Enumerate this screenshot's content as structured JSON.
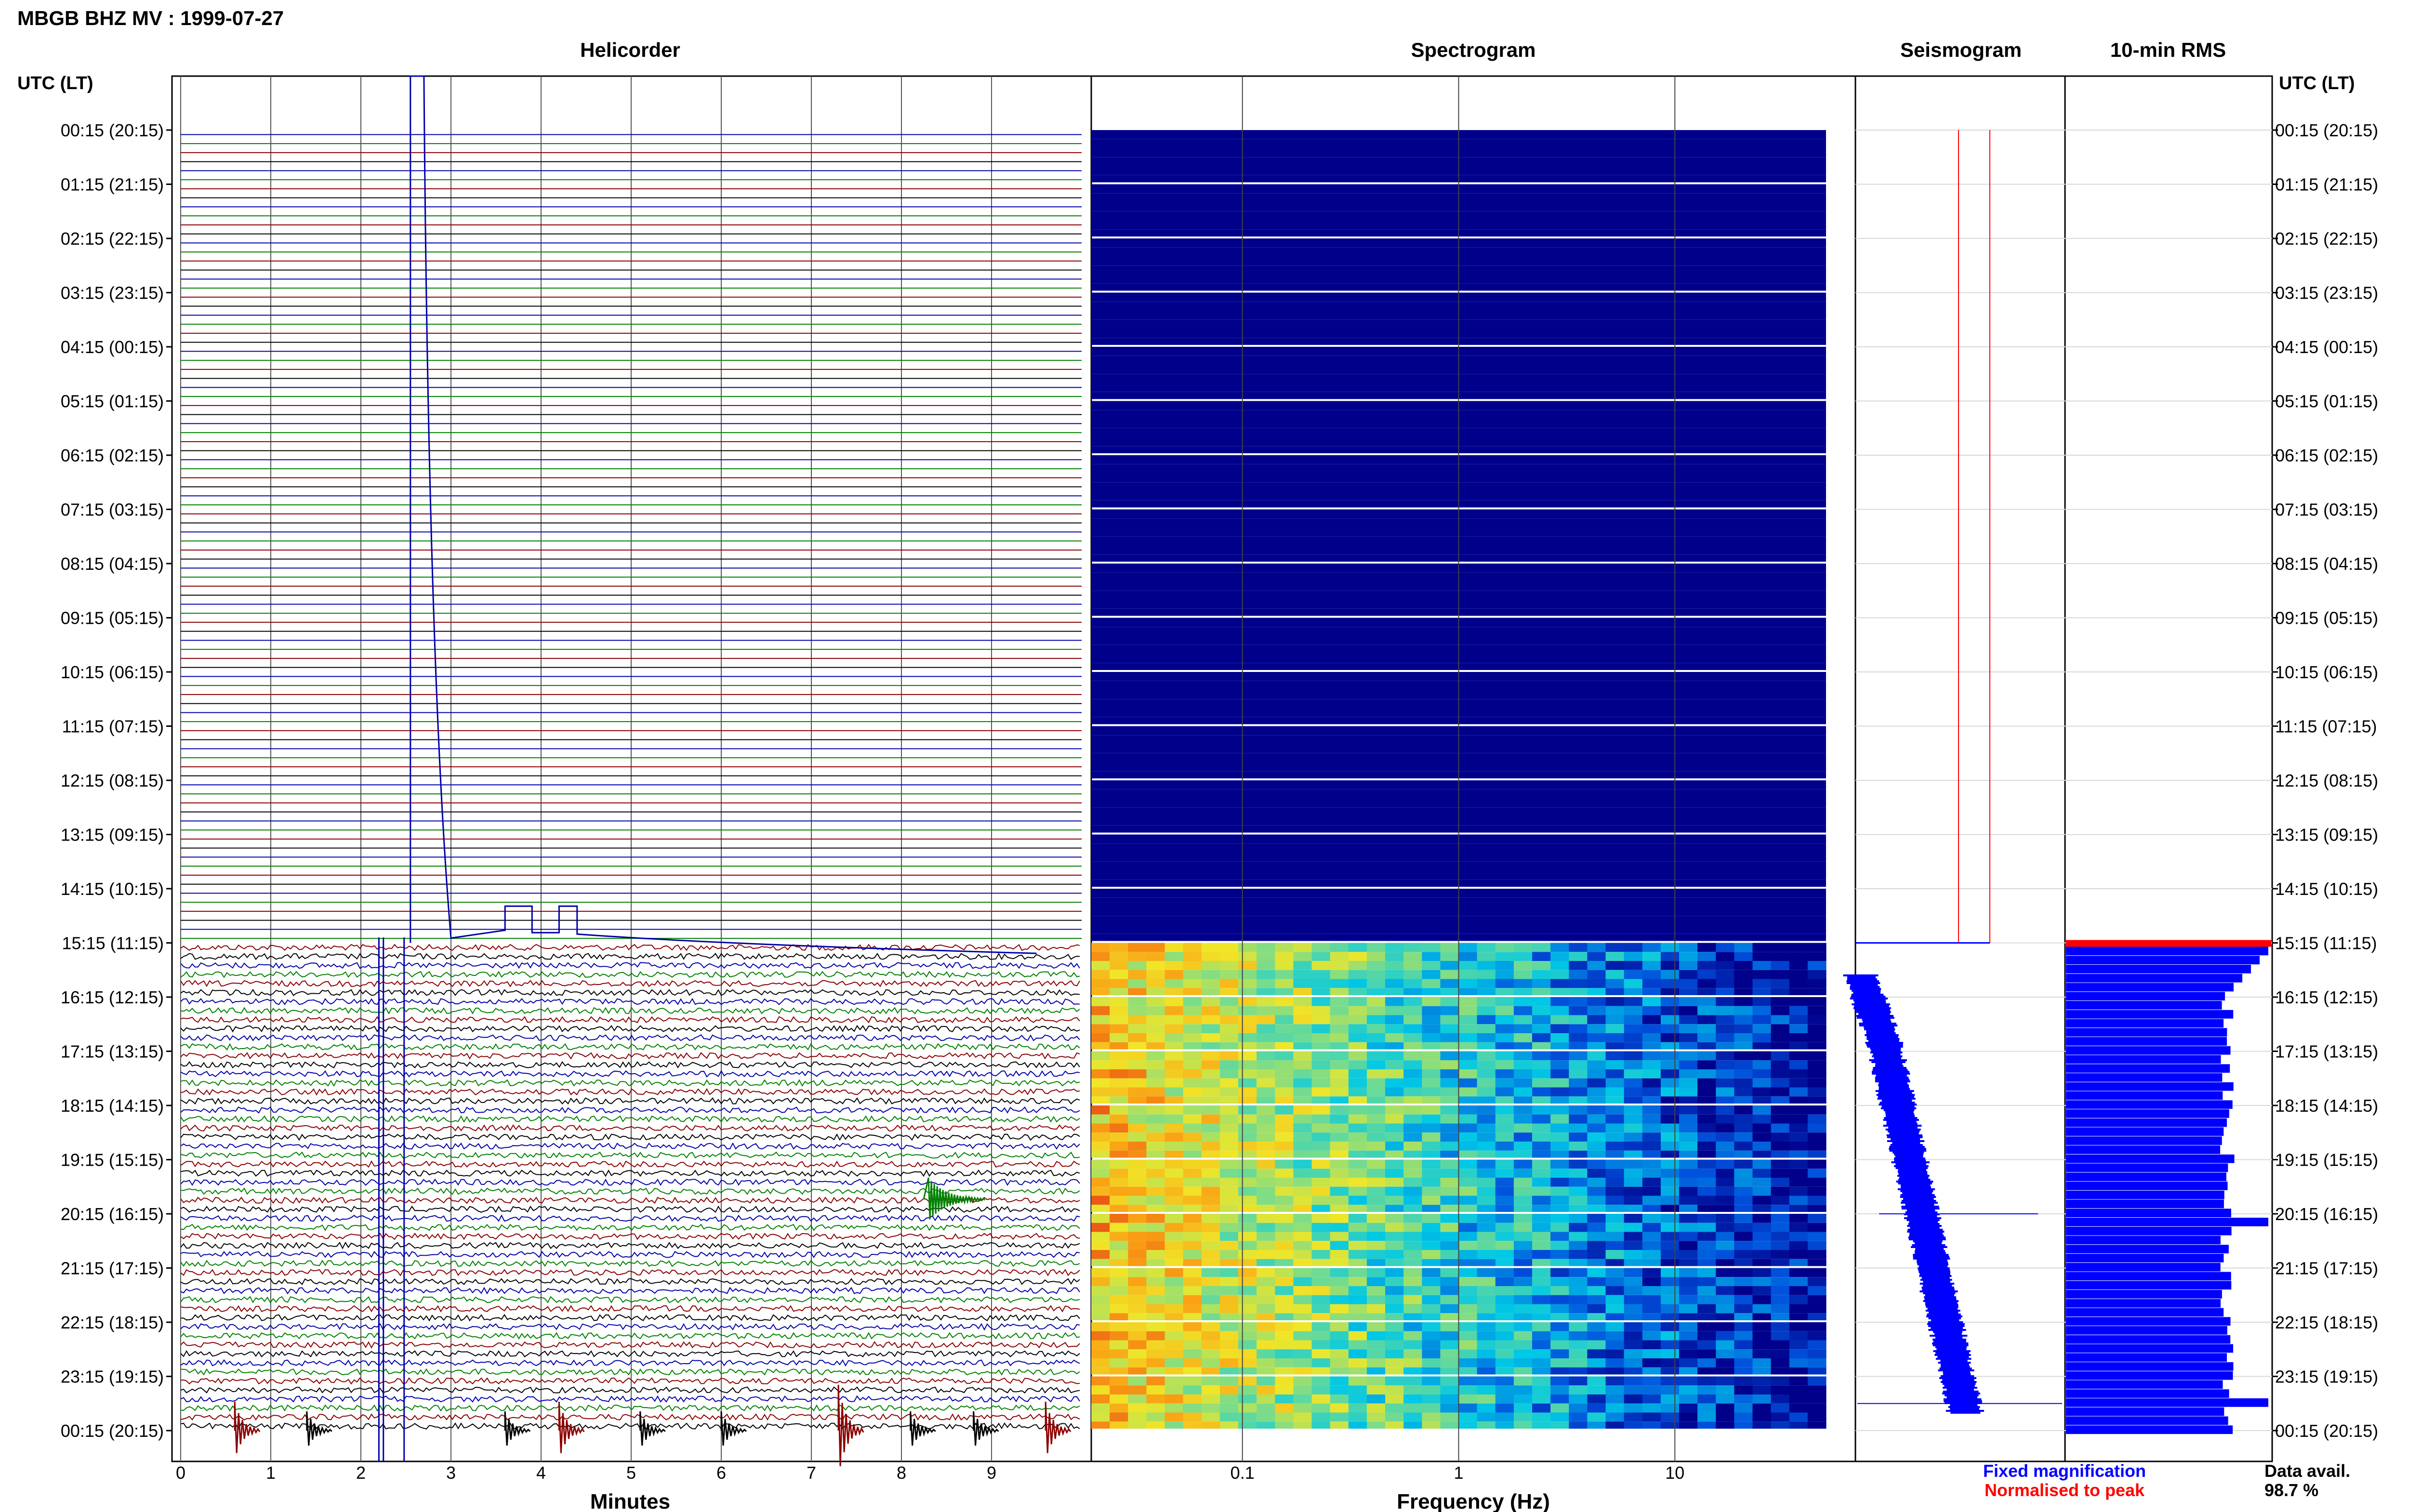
{
  "header": {
    "title": "MBGB BHZ MV : 1999-07-27"
  },
  "panels": {
    "helicorder": "Helicorder",
    "spectrogram": "Spectrogram",
    "seismogram": "Seismogram",
    "rms": "10-min RMS"
  },
  "axis": {
    "time_label": "UTC (LT)",
    "minutes_label": "Minutes",
    "frequency_label": "Frequency (Hz)"
  },
  "legend": {
    "fixed": "Fixed magnification",
    "normalised": "Normalised to peak",
    "fixed_color": "#0000ff",
    "normalised_color": "#ff0000"
  },
  "availability": {
    "label": "Data avail.",
    "value": "98.7 %"
  },
  "colors": {
    "spectrogram_empty": "#00008b",
    "rms_bar": "#0000ff",
    "trace_cycle": [
      "#0000aa",
      "#008000",
      "#8b0000",
      "#000000"
    ]
  },
  "chart_data": [
    {
      "type": "line",
      "title": "Helicorder",
      "xlabel": "Minutes",
      "ylabel": "UTC (LT)",
      "x_ticks": [
        0,
        1,
        2,
        3,
        4,
        5,
        6,
        7,
        8,
        9
      ],
      "xlim": [
        0,
        10
      ],
      "y_tick_labels": [
        "00:15 (20:15)",
        "01:15 (21:15)",
        "02:15 (22:15)",
        "03:15 (23:15)",
        "04:15 (00:15)",
        "05:15 (01:15)",
        "06:15 (02:15)",
        "07:15 (03:15)",
        "08:15 (04:15)",
        "09:15 (05:15)",
        "10:15 (06:15)",
        "11:15 (07:15)",
        "12:15 (08:15)",
        "13:15 (09:15)",
        "14:15 (10:15)",
        "15:15 (11:15)",
        "16:15 (12:15)",
        "17:15 (13:15)",
        "18:15 (14:15)",
        "19:15 (15:15)",
        "20:15 (16:15)",
        "21:15 (17:15)",
        "22:15 (18:15)",
        "23:15 (19:15)",
        "00:15 (20:15)"
      ],
      "flat_until": "15:15 UTC",
      "events_minutes": [
        0.6,
        1.4,
        3.6,
        4.2,
        5.1,
        6.0,
        7.3,
        8.1,
        8.8,
        9.6
      ],
      "grid": true
    },
    {
      "type": "heatmap",
      "title": "Spectrogram",
      "xlabel": "Frequency (Hz)",
      "x_scale": "log",
      "x_tick_labels": [
        "0.1",
        "1",
        "10"
      ],
      "xlim": [
        0.02,
        50
      ],
      "data_start": "15:15 UTC"
    },
    {
      "type": "line",
      "title": "Seismogram",
      "series": [
        {
          "name": "Fixed magnification"
        },
        {
          "name": "Normalised to peak"
        }
      ]
    },
    {
      "type": "bar",
      "title": "10-min RMS",
      "data_start": "15:15 UTC",
      "peak_at": "20:15 UTC"
    }
  ]
}
